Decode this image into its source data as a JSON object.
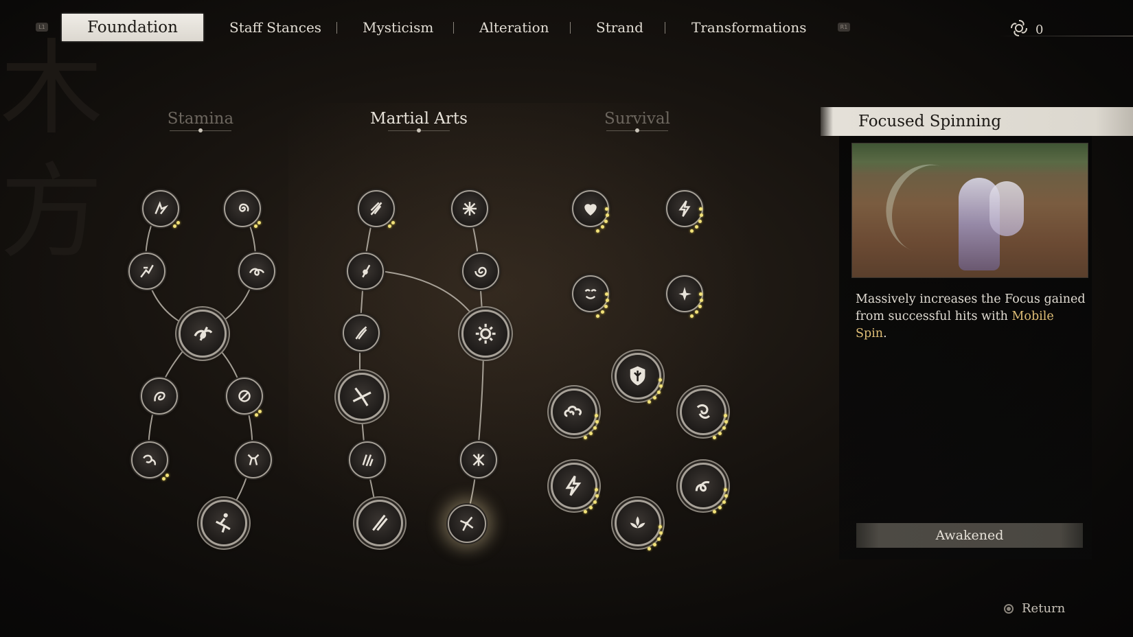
{
  "nav": {
    "left_hint": "L1",
    "right_hint": "R1",
    "tabs": [
      {
        "label": "Foundation",
        "active": true
      },
      {
        "label": "Staff Stances",
        "active": false
      },
      {
        "label": "Mysticism",
        "active": false
      },
      {
        "label": "Alteration",
        "active": false
      },
      {
        "label": "Strand",
        "active": false
      },
      {
        "label": "Transformations",
        "active": false
      }
    ],
    "currency_icon": "sparks-icon",
    "currency_value": "0"
  },
  "columns": [
    {
      "title": "Stamina",
      "active": false
    },
    {
      "title": "Martial Arts",
      "active": true
    },
    {
      "title": "Survival",
      "active": false
    }
  ],
  "skill_tree": {
    "stamina": [
      {
        "icon": "swift-step-icon",
        "pips": 2
      },
      {
        "icon": "spiral-icon",
        "pips": 2
      },
      {
        "icon": "dash-icon",
        "pips": 0
      },
      {
        "icon": "wave-icon",
        "pips": 0
      },
      {
        "icon": "core-stamina-icon",
        "pips": 0
      },
      {
        "icon": "sigh-icon",
        "pips": 0
      },
      {
        "icon": "swirl-icon",
        "pips": 2
      },
      {
        "icon": "tiger-icon",
        "pips": 2
      },
      {
        "icon": "beast-icon",
        "pips": 0
      },
      {
        "icon": "leap-icon",
        "pips": 0
      }
    ],
    "martial": [
      {
        "icon": "staff-strike-icon",
        "pips": 2
      },
      {
        "icon": "burst-icon",
        "pips": 0
      },
      {
        "icon": "pin-icon",
        "pips": 0
      },
      {
        "icon": "vortex-icon",
        "pips": 0
      },
      {
        "icon": "slash-icon",
        "pips": 0
      },
      {
        "icon": "sun-ring-icon",
        "pips": 0
      },
      {
        "icon": "pinwheel-icon",
        "pips": 0
      },
      {
        "icon": "claw-icon",
        "pips": 0
      },
      {
        "icon": "cross-spark-icon",
        "pips": 0
      },
      {
        "icon": "twin-staff-icon",
        "pips": 0
      },
      {
        "icon": "focused-spin-icon",
        "pips": 0,
        "selected": true
      }
    ],
    "survival": [
      {
        "icon": "heart-icon",
        "pips": 4
      },
      {
        "icon": "lightning-icon",
        "pips": 4
      },
      {
        "icon": "face-icon",
        "pips": 4
      },
      {
        "icon": "sparkle-icon",
        "pips": 4
      },
      {
        "icon": "shield-icon",
        "pips": 4
      },
      {
        "icon": "cloud-icon",
        "pips": 4
      },
      {
        "icon": "spirit-icon",
        "pips": 4
      },
      {
        "icon": "thunder-icon",
        "pips": 4
      },
      {
        "icon": "serpent-icon",
        "pips": 4
      },
      {
        "icon": "lotus-icon",
        "pips": 4
      }
    ]
  },
  "detail": {
    "title": "Focused Spinning",
    "description_pre": "Massively increases the Focus gained from successful hits with ",
    "description_highlight": "Mobile Spin",
    "description_post": ".",
    "status": "Awakened"
  },
  "footer": {
    "return_label": "Return"
  },
  "colors": {
    "accent_highlight": "#e0bf77",
    "pip": "#f2e27a",
    "active_tab_bg": "#e4e0d8"
  }
}
